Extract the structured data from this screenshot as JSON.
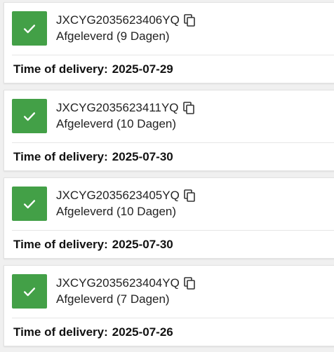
{
  "shipments": [
    {
      "tracking_number": "JXCYG2035623406YQ",
      "status_text": "Afgeleverd (9 Dagen)",
      "delivery_label": "Time of delivery:",
      "delivery_date": "2025-07-29",
      "status_icon": "check-icon",
      "copy_icon": "copy-icon"
    },
    {
      "tracking_number": "JXCYG2035623411YQ",
      "status_text": "Afgeleverd (10 Dagen)",
      "delivery_label": "Time of delivery:",
      "delivery_date": "2025-07-30",
      "status_icon": "check-icon",
      "copy_icon": "copy-icon"
    },
    {
      "tracking_number": "JXCYG2035623405YQ",
      "status_text": "Afgeleverd (10 Dagen)",
      "delivery_label": "Time of delivery:",
      "delivery_date": "2025-07-30",
      "status_icon": "check-icon",
      "copy_icon": "copy-icon"
    },
    {
      "tracking_number": "JXCYG2035623404YQ",
      "status_text": "Afgeleverd (7 Dagen)",
      "delivery_label": "Time of delivery:",
      "delivery_date": "2025-07-26",
      "status_icon": "check-icon",
      "copy_icon": "copy-icon"
    }
  ],
  "colors": {
    "status_delivered": "#43a047",
    "card_background": "#ffffff",
    "page_background": "#f0f0f0"
  }
}
